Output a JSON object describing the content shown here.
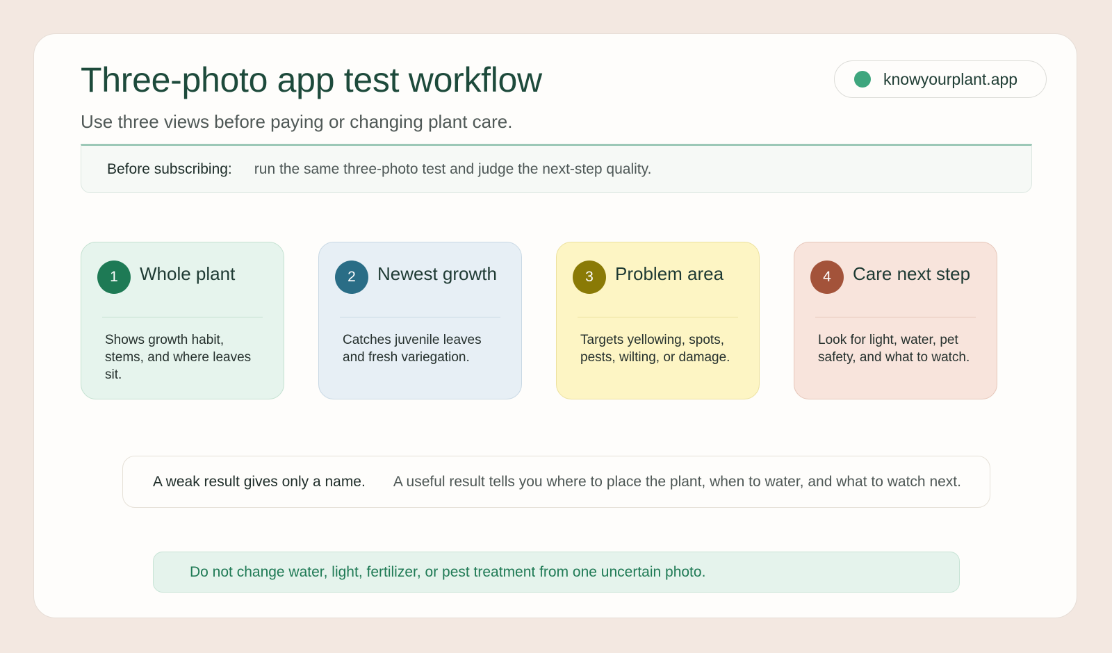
{
  "header": {
    "title": "Three-photo app test workflow",
    "subtitle": "Use three views before paying or changing plant care."
  },
  "brand": {
    "name": "knowyourplant.app",
    "dot_color": "#3ea67e"
  },
  "note": {
    "label": "Before subscribing:",
    "text": "run the same three-photo test and judge the next-step quality."
  },
  "steps": [
    {
      "number": "1",
      "title": "Whole plant",
      "description": "Shows growth habit, stems, and where leaves sit.",
      "badge_color": "#1e7a55",
      "card_bg": "#e6f4ed",
      "border_color": "#c4e1d1"
    },
    {
      "number": "2",
      "title": "Newest growth",
      "description": "Catches juvenile leaves and fresh variegation.",
      "badge_color": "#2a6d86",
      "card_bg": "#e7eff5",
      "border_color": "#c8d8e4"
    },
    {
      "number": "3",
      "title": "Problem area",
      "description": "Targets yellowing, spots, pests, wilting, or damage.",
      "badge_color": "#8a7a06",
      "card_bg": "#fdf5c4",
      "border_color": "#ece19e"
    },
    {
      "number": "4",
      "title": "Care next step",
      "description": "Look for light, water, pet safety, and what to watch.",
      "badge_color": "#a3533a",
      "card_bg": "#f8e4dc",
      "border_color": "#e6c7ba"
    }
  ],
  "result": {
    "weak": "A weak result gives only a name.",
    "useful": "A useful result tells you where to place the plant, when to water, and what to watch next."
  },
  "warning": {
    "text": "Do not change water, light, fertilizer, or pest treatment from one uncertain photo."
  }
}
